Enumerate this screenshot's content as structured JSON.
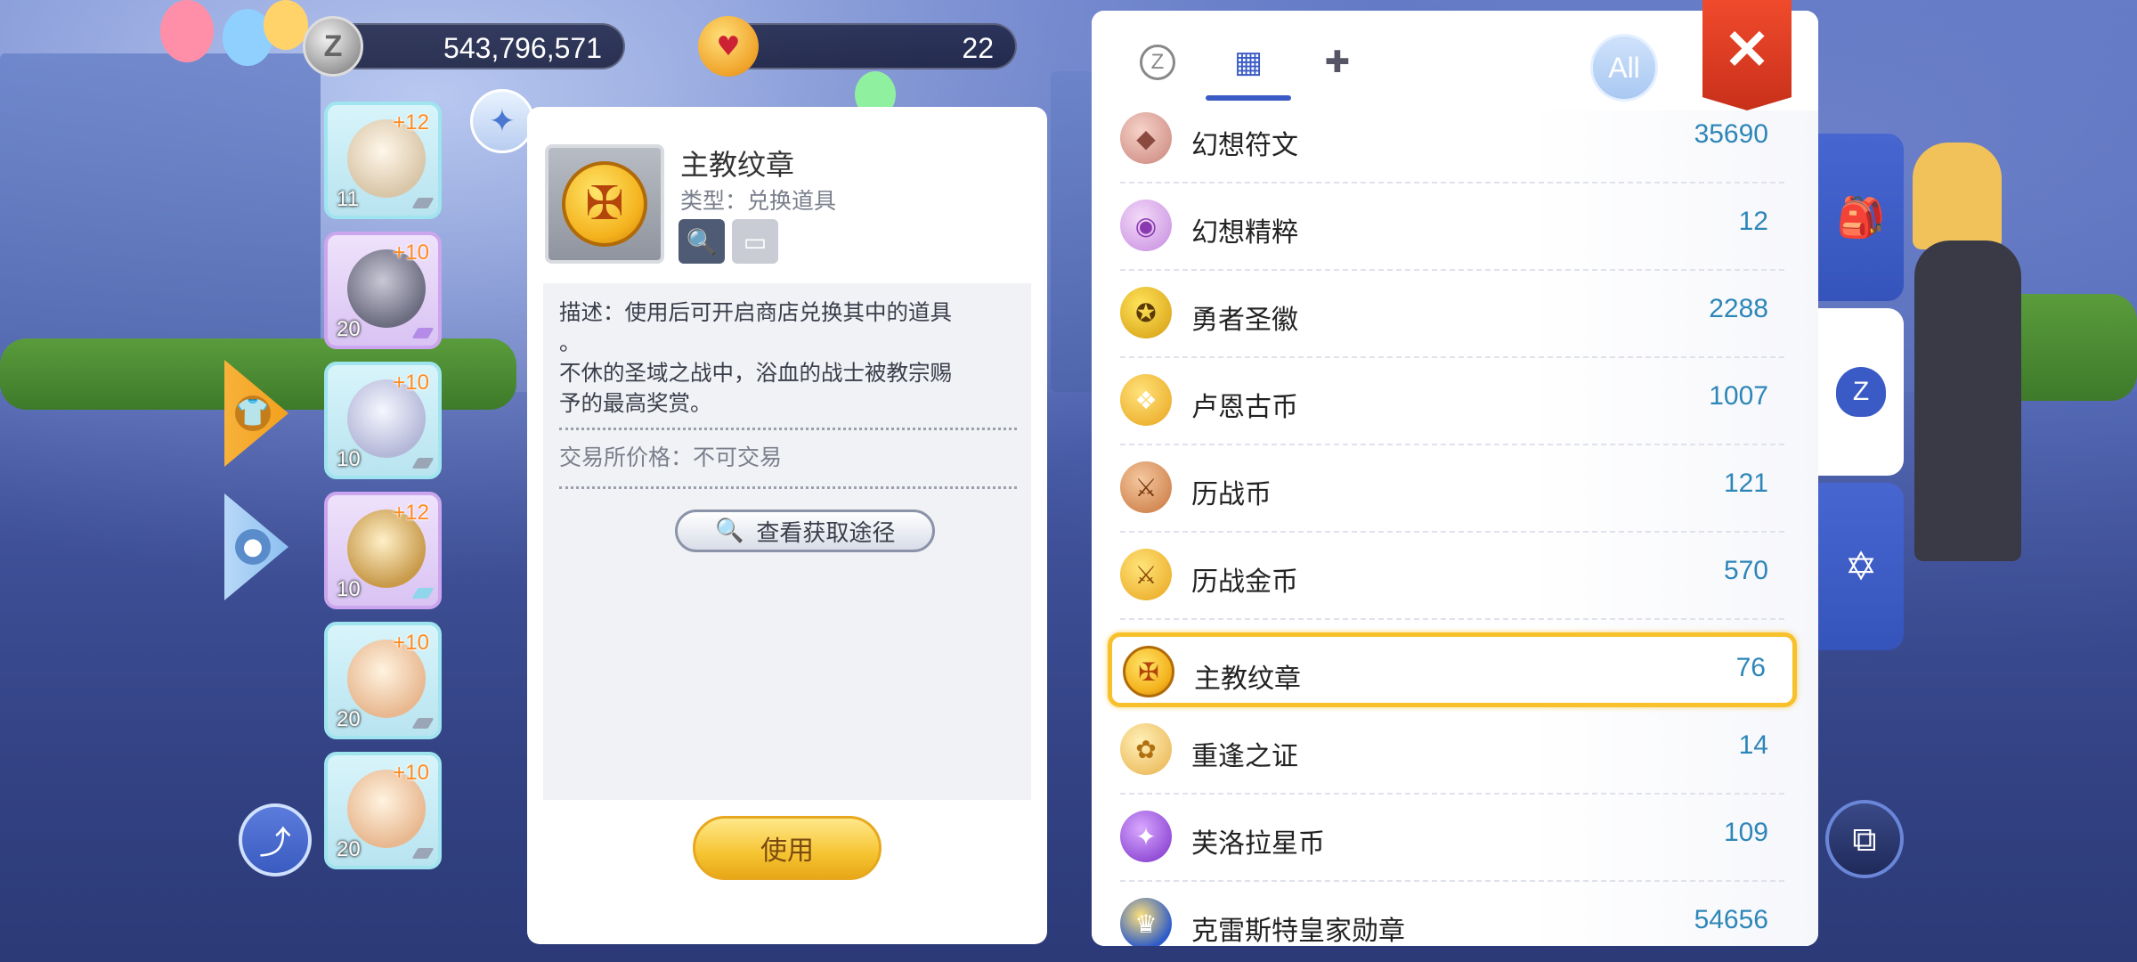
{
  "currencies": {
    "zeny": {
      "icon": "zeny-coin-icon",
      "value": "543,796,571"
    },
    "cat_coin": {
      "icon": "cat-coin-icon",
      "value": "22"
    }
  },
  "equipment": [
    {
      "icon": "skull-helmet-icon",
      "refine": "+12",
      "count": "11"
    },
    {
      "icon": "armor-icon",
      "refine": "+10",
      "count": "20"
    },
    {
      "icon": "shield-icon",
      "refine": "+10",
      "count": "10"
    },
    {
      "icon": "boots-icon",
      "refine": "+12",
      "count": "10"
    },
    {
      "icon": "necklace-icon",
      "refine": "+10",
      "count": "20"
    },
    {
      "icon": "necklace-icon",
      "refine": "+10",
      "count": "20"
    }
  ],
  "detail": {
    "name": "主教纹章",
    "type": "类型：兑换道具",
    "description_line1": "描述：使用后可开启商店兑换其中的道具",
    "description_line2": "。",
    "description_line3": "不休的圣域之战中，浴血的战士被教宗赐",
    "description_line4": "予的最高奖赏。",
    "price": "交易所价格：不可交易",
    "route_button": "查看获取途径",
    "use_button": "使用"
  },
  "tabs": {
    "all_label": "All",
    "close_symbol": "✕"
  },
  "items": [
    {
      "name": "幻想符文",
      "count": "35690",
      "color": "#e8a8a0"
    },
    {
      "name": "幻想精粹",
      "count": "12",
      "color": "#d79be6"
    },
    {
      "name": "勇者圣徽",
      "count": "2288",
      "color": "#e8b520"
    },
    {
      "name": "卢恩古币",
      "count": "1007",
      "color": "#f1bb2c"
    },
    {
      "name": "历战币",
      "count": "121",
      "color": "#d9804a"
    },
    {
      "name": "历战金币",
      "count": "570",
      "color": "#f0b526"
    },
    {
      "name": "主教纹章",
      "count": "76",
      "color": "#f4b21d"
    },
    {
      "name": "重逢之证",
      "count": "14",
      "color": "#f3c460"
    },
    {
      "name": "芙洛拉星币",
      "count": "109",
      "color": "#9b4fd8"
    },
    {
      "name": "克雷斯特皇家勋章",
      "count": "54656",
      "color": "#3b6bd0"
    }
  ],
  "side_tabs": [
    "backpack-icon",
    "zeny-bag-icon",
    "hexagram-icon"
  ]
}
